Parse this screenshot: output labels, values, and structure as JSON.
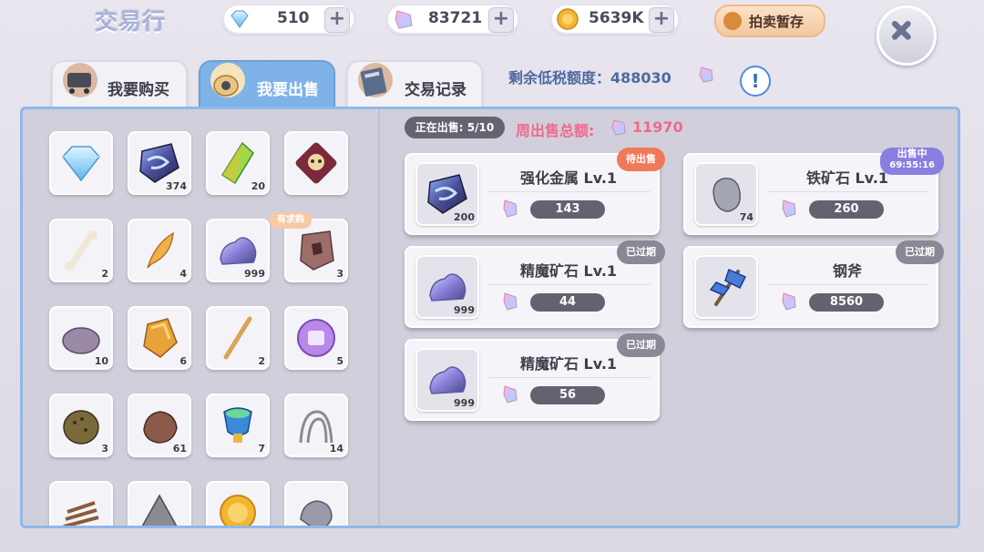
{
  "header": {
    "title": "交易行",
    "currencies": {
      "diamond": "510",
      "crystal": "83721",
      "gold": "5639K"
    },
    "plus_label": "+",
    "auction_label": "拍卖暂存"
  },
  "tabs": [
    {
      "label": "我要购买"
    },
    {
      "label": "我要出售"
    },
    {
      "label": "交易记录"
    }
  ],
  "tax": {
    "label": "剩余低税额度：488030",
    "info_label": "!"
  },
  "inventory": {
    "wanted_tag": "有求购",
    "counts": {
      "slot2": "374",
      "slot3": "20",
      "slot6": "2",
      "slot7": "4",
      "slot8": "999",
      "slot9": "3",
      "slot10": "10",
      "slot11": "6",
      "slot12": "2",
      "slot13": "5",
      "slot14": "3",
      "slot15": "61",
      "slot16": "7",
      "slot17": "14"
    }
  },
  "sale": {
    "on_sale_label": "正在出售: 5/10",
    "weekly_label": "周出售总额:",
    "weekly_value": "11970",
    "listings": [
      {
        "name": "强化金属 Lv.1",
        "qty": "200",
        "price": "143",
        "status": "待出售"
      },
      {
        "name": "铁矿石 Lv.1",
        "qty": "74",
        "price": "260",
        "status": "出售中",
        "timer": "69:55:16"
      },
      {
        "name": "精魔矿石 Lv.1",
        "qty": "999",
        "price": "44",
        "status": "已过期"
      },
      {
        "name": "钢斧",
        "qty": "",
        "price": "8560",
        "status": "已过期"
      },
      {
        "name": "精魔矿石 Lv.1",
        "qty": "999",
        "price": "56",
        "status": "已过期"
      }
    ]
  },
  "colors": {
    "accent": "#7fb3e8",
    "price_pill": "#656170",
    "weekly_text": "#f06a8c",
    "badge_pending": "#ef7a5a",
    "badge_selling": "#8a7fe0",
    "badge_expired": "#8a8894"
  }
}
